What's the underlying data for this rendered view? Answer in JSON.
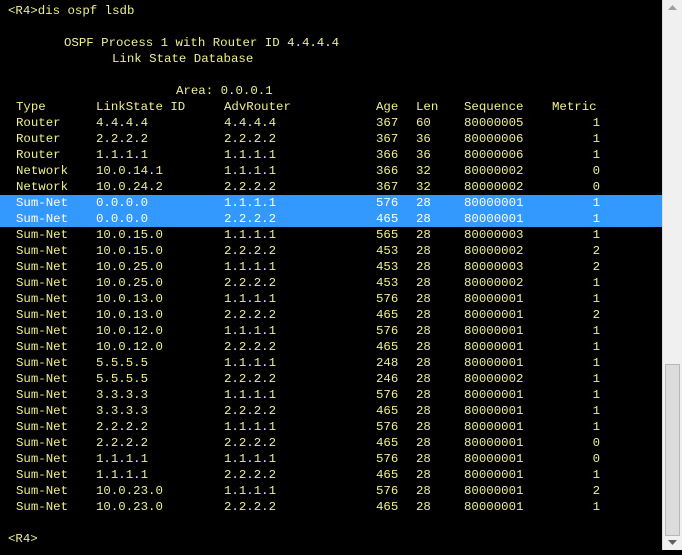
{
  "command_line": "<R4>dis ospf lsdb",
  "title_line1": "OSPF Process 1 with Router ID 4.4.4.4",
  "title_line2": "Link State Database",
  "area_line": "Area: 0.0.0.1",
  "headers": [
    "Type",
    "LinkState ID",
    "AdvRouter",
    "Age",
    "Len",
    "Sequence",
    "Metric"
  ],
  "rows": [
    {
      "type": "Router",
      "lsid": "4.4.4.4",
      "adv": "4.4.4.4",
      "age": "367",
      "len": "60",
      "seq": "80000005",
      "metric": "1"
    },
    {
      "type": "Router",
      "lsid": "2.2.2.2",
      "adv": "2.2.2.2",
      "age": "367",
      "len": "36",
      "seq": "80000006",
      "metric": "1"
    },
    {
      "type": "Router",
      "lsid": "1.1.1.1",
      "adv": "1.1.1.1",
      "age": "366",
      "len": "36",
      "seq": "80000006",
      "metric": "1"
    },
    {
      "type": "Network",
      "lsid": "10.0.14.1",
      "adv": "1.1.1.1",
      "age": "366",
      "len": "32",
      "seq": "80000002",
      "metric": "0"
    },
    {
      "type": "Network",
      "lsid": "10.0.24.2",
      "adv": "2.2.2.2",
      "age": "367",
      "len": "32",
      "seq": "80000002",
      "metric": "0"
    },
    {
      "type": "Sum-Net",
      "lsid": "0.0.0.0",
      "adv": "1.1.1.1",
      "age": "576",
      "len": "28",
      "seq": "80000001",
      "metric": "1"
    },
    {
      "type": "Sum-Net",
      "lsid": "0.0.0.0",
      "adv": "2.2.2.2",
      "age": "465",
      "len": "28",
      "seq": "80000001",
      "metric": "1"
    },
    {
      "type": "Sum-Net",
      "lsid": "10.0.15.0",
      "adv": "1.1.1.1",
      "age": "565",
      "len": "28",
      "seq": "80000003",
      "metric": "1"
    },
    {
      "type": "Sum-Net",
      "lsid": "10.0.15.0",
      "adv": "2.2.2.2",
      "age": "453",
      "len": "28",
      "seq": "80000002",
      "metric": "2"
    },
    {
      "type": "Sum-Net",
      "lsid": "10.0.25.0",
      "adv": "1.1.1.1",
      "age": "453",
      "len": "28",
      "seq": "80000003",
      "metric": "2"
    },
    {
      "type": "Sum-Net",
      "lsid": "10.0.25.0",
      "adv": "2.2.2.2",
      "age": "453",
      "len": "28",
      "seq": "80000002",
      "metric": "1"
    },
    {
      "type": "Sum-Net",
      "lsid": "10.0.13.0",
      "adv": "1.1.1.1",
      "age": "576",
      "len": "28",
      "seq": "80000001",
      "metric": "1"
    },
    {
      "type": "Sum-Net",
      "lsid": "10.0.13.0",
      "adv": "2.2.2.2",
      "age": "465",
      "len": "28",
      "seq": "80000001",
      "metric": "2"
    },
    {
      "type": "Sum-Net",
      "lsid": "10.0.12.0",
      "adv": "1.1.1.1",
      "age": "576",
      "len": "28",
      "seq": "80000001",
      "metric": "1"
    },
    {
      "type": "Sum-Net",
      "lsid": "10.0.12.0",
      "adv": "2.2.2.2",
      "age": "465",
      "len": "28",
      "seq": "80000001",
      "metric": "1"
    },
    {
      "type": "Sum-Net",
      "lsid": "5.5.5.5",
      "adv": "1.1.1.1",
      "age": "248",
      "len": "28",
      "seq": "80000001",
      "metric": "1"
    },
    {
      "type": "Sum-Net",
      "lsid": "5.5.5.5",
      "adv": "2.2.2.2",
      "age": "246",
      "len": "28",
      "seq": "80000002",
      "metric": "1"
    },
    {
      "type": "Sum-Net",
      "lsid": "3.3.3.3",
      "adv": "1.1.1.1",
      "age": "576",
      "len": "28",
      "seq": "80000001",
      "metric": "1"
    },
    {
      "type": "Sum-Net",
      "lsid": "3.3.3.3",
      "adv": "2.2.2.2",
      "age": "465",
      "len": "28",
      "seq": "80000001",
      "metric": "1"
    },
    {
      "type": "Sum-Net",
      "lsid": "2.2.2.2",
      "adv": "1.1.1.1",
      "age": "576",
      "len": "28",
      "seq": "80000001",
      "metric": "1"
    },
    {
      "type": "Sum-Net",
      "lsid": "2.2.2.2",
      "adv": "2.2.2.2",
      "age": "465",
      "len": "28",
      "seq": "80000001",
      "metric": "0"
    },
    {
      "type": "Sum-Net",
      "lsid": "1.1.1.1",
      "adv": "1.1.1.1",
      "age": "576",
      "len": "28",
      "seq": "80000001",
      "metric": "0"
    },
    {
      "type": "Sum-Net",
      "lsid": "1.1.1.1",
      "adv": "2.2.2.2",
      "age": "465",
      "len": "28",
      "seq": "80000001",
      "metric": "1"
    },
    {
      "type": "Sum-Net",
      "lsid": "10.0.23.0",
      "adv": "1.1.1.1",
      "age": "576",
      "len": "28",
      "seq": "80000001",
      "metric": "2"
    },
    {
      "type": "Sum-Net",
      "lsid": "10.0.23.0",
      "adv": "2.2.2.2",
      "age": "465",
      "len": "28",
      "seq": "80000001",
      "metric": "1"
    }
  ],
  "selected_rows": [
    5,
    6
  ],
  "prompt": "<R4>",
  "colors": {
    "background": "#000000",
    "text": "#f0f08c",
    "selection": "#3399ff",
    "selection_text": "#ffffff"
  },
  "icons": {
    "scroll_up": "arrow-up-icon",
    "scroll_down": "arrow-down-icon"
  }
}
